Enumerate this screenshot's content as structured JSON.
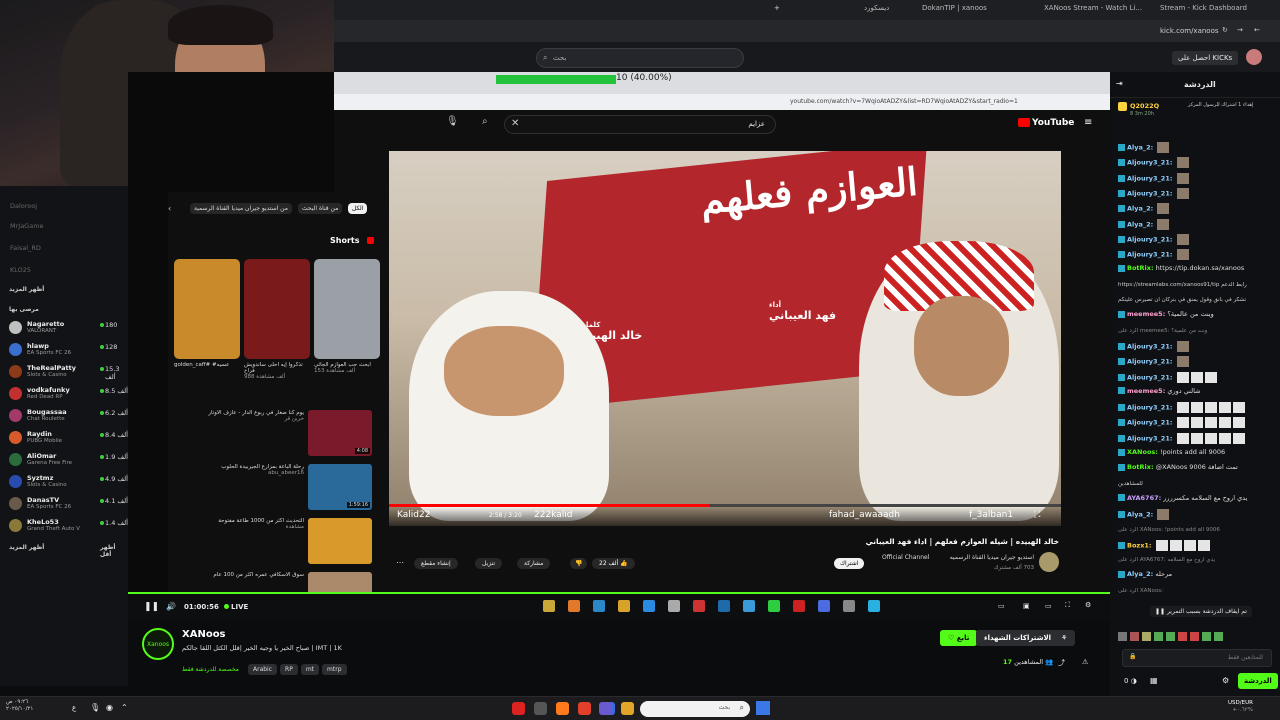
{
  "browser": {
    "tabs": [
      "Stream - Kick Dashboard",
      "XANoos Stream - Watch Li...",
      "DokanTIP | xanoos",
      "ديسكورد"
    ],
    "url": "kick.com/xanoos"
  },
  "kick": {
    "search_placeholder": "بحث",
    "get_kicks": "احصل على KICKs",
    "progress_text": "10 (40.00%)"
  },
  "sidebar": {
    "dim_items": [
      "Dalorooj",
      "MrJaGame",
      "Faisal_RD",
      "KLO25"
    ],
    "section_more": "أظهر المزيد",
    "section_recommended": "مرصى بها",
    "channels": [
      {
        "name": "Nagaretto",
        "game": "VALORANT",
        "count": "180",
        "color": "#c0c0c0"
      },
      {
        "name": "hlawp",
        "game": "EA Sports FC 26",
        "count": "128",
        "color": "#3a6fd0"
      },
      {
        "name": "TheRealPatty",
        "game": "Slots & Casino",
        "count": "15.3 ألف",
        "color": "#8c3a1a"
      },
      {
        "name": "vodkafunky",
        "game": "Red Dead RP",
        "count": "8.5 ألف",
        "color": "#c23030"
      },
      {
        "name": "Bougassaa",
        "game": "Chat Roulette",
        "count": "6.2 ألف",
        "color": "#a33a6a"
      },
      {
        "name": "Raydin",
        "game": "PUBG Mobile",
        "count": "8.4 ألف",
        "color": "#d85a2a"
      },
      {
        "name": "AliOmar",
        "game": "Garena Free Fire",
        "count": "1.9 ألف",
        "color": "#2a6c3c"
      },
      {
        "name": "Syztmz",
        "game": "Slots & Casino",
        "count": "4.9 ألف",
        "color": "#2a4cb0"
      },
      {
        "name": "DanasTV",
        "game": "EA Sports FC 26",
        "count": "4.1 ألف",
        "color": "#6a5a4a"
      },
      {
        "name": "KheLo53",
        "game": "Grand Theft Auto V",
        "count": "1.4 ألف",
        "color": "#8a7a3a"
      }
    ],
    "show_more": "أظهر المزيد",
    "show_less": "أظهر أقل"
  },
  "youtube": {
    "url": "youtube.com/watch?v=7WqioAtADZY&list=RD7WqioAtADZY&start_radio=1",
    "search_value": "عزايم",
    "logo": "YouTube",
    "shorts_label": "Shorts",
    "chips": [
      "الكل",
      "من قناة البحث",
      "من استديو جيران ميديا القناة الرسمية"
    ],
    "shorts": [
      {
        "title": "golden_caff# #عسيه",
        "views": "",
        "color": "#c88a2a"
      },
      {
        "title": "تذكروا إيه أحلى ساندويش فراخ",
        "views": "988 ألف مشاهدة",
        "color": "#7a1a1a"
      },
      {
        "title": "ابحث حب العوازم الجاثي",
        "views": "153 ألف مشاهدة",
        "color": "#9aa0a6"
      }
    ],
    "side_videos": [
      {
        "title": "يوم كنا صغار في ربوع الدار - عازف الأوتار",
        "meta": "خرين قر",
        "duration": "4:08",
        "color": "#7a1a2a"
      },
      {
        "title": "رحلة الباعة بمزارع الجيربيدة الحلوب",
        "meta": "abu_abeer16",
        "duration": "1:59:16",
        "color": "#2a6a9a"
      },
      {
        "title": "التحديث أكثر من 1000 طاعة مفتوحة",
        "meta": "مشاهدة",
        "duration": "",
        "color": "#d89a2a"
      },
      {
        "title": "سوق الاسكافي عمره أكثر من 100 عام",
        "meta": "",
        "duration": "",
        "color": "#aa8a6a"
      }
    ],
    "thumbnail": {
      "title_art": "العوازم فعلهم",
      "credit_performer_label": "أداء",
      "credit_performer": "فهد العيباني",
      "credit_words_label": "كلمات",
      "credit_words": "خالد الهبيده"
    },
    "player": {
      "time": "2:58 / 3:20",
      "channel_overlay": "222kalid",
      "handle_overlay": "fahad_awaaadh",
      "name_overlay": "f_3alban1",
      "left_overlay": "Kalid22"
    },
    "video_title": "خالد الهبيده | شيله العوازم فعلهم | اداء فهد العيباني",
    "channel": "استديو جيران ميديا القناة الرسميه",
    "channel_badge": "Official Channel",
    "subs": "703 ألف مشترك",
    "subscribe": "اشتراك",
    "likes": "22 ألف",
    "share": "مشاركة",
    "download": "تنزيل",
    "clip": "إنشاء مقطع"
  },
  "player": {
    "time": "01:00:56",
    "live": "LIVE"
  },
  "stream": {
    "streamer": "XANoos",
    "title": "صباح الخير يا وجيه الخير |قلل الكثل اللقا جالكم | IMT | 1K",
    "category": "مخصصة للدردشة فقط",
    "tags": [
      "Arabic",
      "RP",
      "mt",
      "mtrp"
    ],
    "follow": "تابع",
    "subscriptions": "الاشتراكات الشهداء",
    "viewers_label": "المشاهدين",
    "viewers": "17",
    "avatar_label": "Xanoos"
  },
  "chat": {
    "header": "الدردشة",
    "pinned_user": "Q2022Q",
    "pinned_text": "إهداء 1 اشتراك للرسول المركز",
    "pinned_time": "8 3m 20h",
    "messages": [
      {
        "user": "Alya_2:",
        "text": "",
        "emotes": 1,
        "color": "#8fd0ff"
      },
      {
        "user": "Aljoury3_21:",
        "text": "",
        "emotes": 1,
        "color": "#8fd0ff"
      },
      {
        "user": "Aljoury3_21:",
        "text": "",
        "emotes": 1,
        "color": "#8fd0ff"
      },
      {
        "user": "Aljoury3_21:",
        "text": "",
        "emotes": 1,
        "color": "#8fd0ff"
      },
      {
        "user": "Alya_2:",
        "text": "",
        "emotes": 1,
        "color": "#8fd0ff"
      },
      {
        "user": "Alya_2:",
        "text": "",
        "emotes": 1,
        "color": "#8fd0ff"
      },
      {
        "user": "Aljoury3_21:",
        "text": "",
        "emotes": 1,
        "color": "#8fd0ff"
      },
      {
        "user": "Aljoury3_21:",
        "text": "",
        "emotes": 1,
        "color": "#8fd0ff"
      },
      {
        "user": "BotRix:",
        "text": "https://tip.dokan.sa/xanoos",
        "emotes": 0,
        "color": "#53fc18"
      },
      {
        "user": "",
        "text": "https://streamlabs.com/xanoos91/tip رابط الدعم",
        "emotes": 0,
        "color": "#cfcfcf"
      },
      {
        "user": "",
        "text": "تشكر في بانق وقول يمنق في بنركان ان تصيرس علينكم",
        "emotes": 0,
        "color": "#cfcfcf"
      },
      {
        "user": "meemee5:",
        "text": "وينت من عالمية؟",
        "emotes": 0,
        "color": "#ff9fd0"
      },
      {
        "user": "",
        "text": "الرد على meemee5: ونت من علمية؟",
        "emotes": 0,
        "color": "#888"
      },
      {
        "user": "Aljoury3_21:",
        "text": "",
        "emotes": 1,
        "color": "#8fd0ff"
      },
      {
        "user": "Aljoury3_21:",
        "text": "",
        "emotes": 1,
        "color": "#8fd0ff"
      },
      {
        "user": "Aljoury3_21:",
        "text": "",
        "emotes": 3,
        "color": "#8fd0ff"
      },
      {
        "user": "meemee5:",
        "text": "شالني دوري",
        "emotes": 0,
        "color": "#ff9fd0"
      },
      {
        "user": "Aljoury3_21:",
        "text": "",
        "emotes": 5,
        "color": "#8fd0ff"
      },
      {
        "user": "Aljoury3_21:",
        "text": "",
        "emotes": 5,
        "color": "#8fd0ff"
      },
      {
        "user": "Aljoury3_21:",
        "text": "",
        "emotes": 5,
        "color": "#8fd0ff"
      },
      {
        "user": "XANoos:",
        "text": "!points add all 9006",
        "emotes": 0,
        "color": "#53fc18"
      },
      {
        "user": "BotRix:",
        "text": "@XANoos 9006 تمت اضافة",
        "emotes": 0,
        "color": "#53fc18"
      },
      {
        "user": "",
        "text": "للمشاهدين",
        "emotes": 0,
        "color": "#cfcfcf"
      },
      {
        "user": "AYA6767:",
        "text": "يدي اروح مع السلامه مكسرررر",
        "emotes": 0,
        "color": "#c9a0ff"
      },
      {
        "user": "Alya_2:",
        "text": "",
        "emotes": 1,
        "color": "#8fd0ff"
      },
      {
        "user": "",
        "text": "الرد على XANoos: !points add all 9006",
        "emotes": 0,
        "color": "#888"
      },
      {
        "user": "Bozx1:",
        "text": "",
        "emotes": 4,
        "color": "#ffd23f"
      },
      {
        "user": "",
        "text": "الرد على AYA6767: يدي اروح مع السلامه",
        "emotes": 0,
        "color": "#888"
      },
      {
        "user": "Alya_2:",
        "text": "مرحله",
        "emotes": 0,
        "color": "#8fd0ff"
      },
      {
        "user": "",
        "text": "الرد على XANoos:",
        "emotes": 0,
        "color": "#888"
      }
    ],
    "paused_text": "تم ايقاف الدردشة بسبب التمرير",
    "input_placeholder": "للمتابعين فقط",
    "send_label": "الدردشة",
    "points": "0"
  },
  "taskbar": {
    "search": "بحث",
    "lang": "USD/EUR",
    "change": "+٠.٦٢%",
    "time": "٠٩:٢٦ ص",
    "date": "٢٠٢٥/١٠/٢١",
    "left_lang": "ع"
  }
}
